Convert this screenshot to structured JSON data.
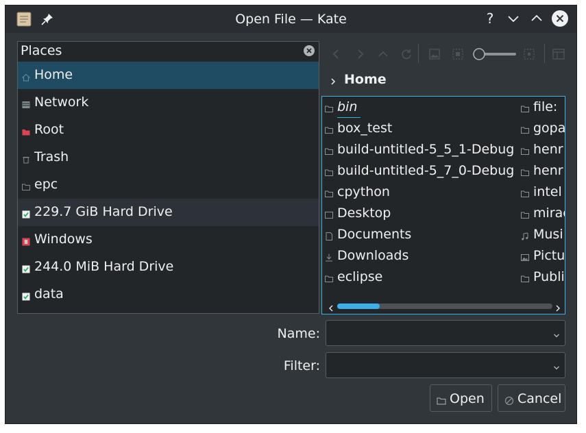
{
  "window": {
    "title": "Open File — Kate"
  },
  "titlebar": {
    "icons": [
      "document-icon",
      "pin-icon",
      "help-icon",
      "minimize-icon",
      "maximize-icon",
      "close-icon"
    ],
    "help_glyph": "?"
  },
  "places": {
    "header": "Places",
    "items": [
      {
        "label": "Home",
        "icon": "home-icon",
        "state": "selected"
      },
      {
        "label": "Network",
        "icon": "network-icon"
      },
      {
        "label": "Root",
        "icon": "root-folder-icon",
        "color": "#da4453"
      },
      {
        "label": "Trash",
        "icon": "trash-icon"
      },
      {
        "label": "epc",
        "icon": "folder-icon"
      },
      {
        "label": "229.7 GiB Hard Drive",
        "icon": "drive-icon",
        "state": "hover"
      },
      {
        "label": "Windows",
        "icon": "windows-drive-icon"
      },
      {
        "label": "244.0 MiB Hard Drive",
        "icon": "drive-icon"
      },
      {
        "label": "data",
        "icon": "drive-icon"
      }
    ]
  },
  "toolbar": {
    "tools": [
      "back-icon",
      "forward-icon",
      "up-icon",
      "reload-icon",
      "preview-icon",
      "zoom-fit-icon",
      "zoom-slider",
      "zoom-select-icon",
      "panel-icon"
    ],
    "zoom_level": 0.0
  },
  "breadcrumb": {
    "current": "Home"
  },
  "files": {
    "column1": [
      {
        "name": "bin",
        "icon": "folder-icon",
        "style": "italic"
      },
      {
        "name": "box_test",
        "icon": "folder-icon"
      },
      {
        "name": "build-untitled-5_5_1-Debug",
        "icon": "folder-icon"
      },
      {
        "name": "build-untitled-5_7_0-Debug",
        "icon": "folder-icon"
      },
      {
        "name": "cpython",
        "icon": "folder-icon"
      },
      {
        "name": "Desktop",
        "icon": "desktop-icon"
      },
      {
        "name": "Documents",
        "icon": "documents-icon"
      },
      {
        "name": "Downloads",
        "icon": "downloads-icon"
      },
      {
        "name": "eclipse",
        "icon": "folder-icon"
      }
    ],
    "column2": [
      {
        "name": "file:",
        "icon": "folder-icon"
      },
      {
        "name": "gopa",
        "icon": "folder-icon"
      },
      {
        "name": "henr",
        "icon": "folder-icon"
      },
      {
        "name": "henr",
        "icon": "folder-icon"
      },
      {
        "name": "intel",
        "icon": "folder-icon"
      },
      {
        "name": "mirac",
        "icon": "folder-icon"
      },
      {
        "name": "Musi",
        "icon": "music-icon"
      },
      {
        "name": "Pictu",
        "icon": "pictures-icon"
      },
      {
        "name": "Publi",
        "icon": "public-icon"
      }
    ],
    "scroll_position": 0.0
  },
  "form": {
    "name_label": "Name:",
    "name_value": "",
    "filter_label": "Filter:",
    "filter_value": ""
  },
  "buttons": {
    "open_label": "Open",
    "cancel_label": "Cancel"
  },
  "colors": {
    "accent": "#3daee9",
    "window_bg": "#31363b",
    "view_bg": "#232629",
    "selection": "#1f4b63",
    "text": "#eff0f1",
    "drive_green": "#27ae60",
    "windows_red": "#da4453"
  }
}
